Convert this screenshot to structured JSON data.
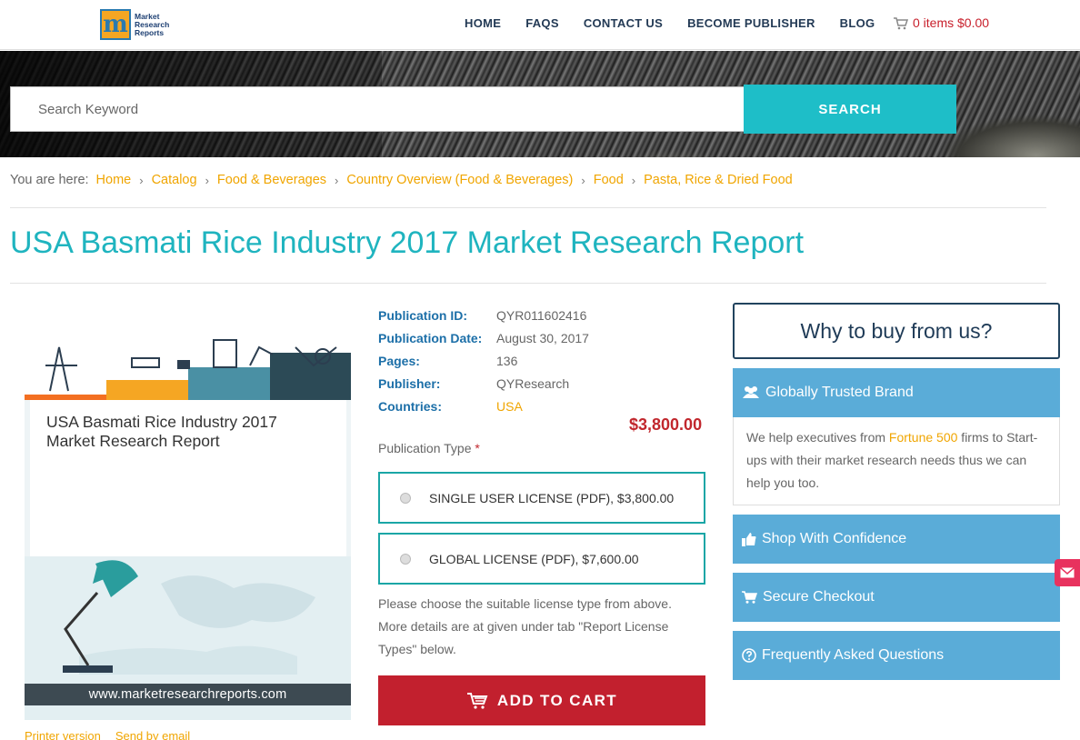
{
  "header": {
    "logo_text": [
      "Market",
      "Research",
      "Reports"
    ],
    "nav": [
      "HOME",
      "FAQS",
      "CONTACT US",
      "BECOME PUBLISHER",
      "BLOG"
    ],
    "cart": "0 items $0.00"
  },
  "search": {
    "placeholder": "Search Keyword",
    "button": "SEARCH"
  },
  "breadcrumb": {
    "lead": "You are here:",
    "items": [
      "Home",
      "Catalog",
      "Food & Beverages",
      "Country Overview (Food & Beverages)",
      "Food",
      "Pasta, Rice & Dried Food"
    ]
  },
  "title": "USA Basmati Rice Industry 2017 Market Research Report",
  "cover": {
    "title": "USA Basmati Rice Industry 2017 Market Research Report",
    "footer": "www.marketresearchreports.com",
    "links": [
      "Printer version",
      "Send by email"
    ]
  },
  "meta": [
    {
      "key": "Publication ID:",
      "value": "QYR011602416"
    },
    {
      "key": "Publication Date:",
      "value": "August 30, 2017"
    },
    {
      "key": "Pages:",
      "value": "136"
    },
    {
      "key": "Publisher:",
      "value": "QYResearch"
    },
    {
      "key": "Countries:",
      "value": "USA"
    }
  ],
  "price": "$3,800.00",
  "pub_type_label": "Publication Type",
  "pub_type_required": "*",
  "licenses": [
    "SINGLE USER LICENSE (PDF), $3,800.00",
    "GLOBAL LICENSE (PDF), $7,600.00"
  ],
  "note": "Please choose the suitable license type from above. More details are at given under tab \"Report License Types\" below.",
  "add_to_cart": "ADD TO CART",
  "sidebar": {
    "why": "Why to buy from us?",
    "trusted": "Globally Trusted Brand",
    "trusted_body_pre": "We help executives from ",
    "trusted_body_hl": "Fortune 500",
    "trusted_body_post": " firms to Start-ups with their market research needs thus we can help you too.",
    "shop": "Shop With Confidence",
    "secure": "Secure Checkout",
    "faq": "Frequently Asked Questions"
  },
  "colors": {
    "accent": "#1fb4bf",
    "link": "#f0a500",
    "cart_red": "#c2202e",
    "panel_blue": "#5aacd8"
  }
}
